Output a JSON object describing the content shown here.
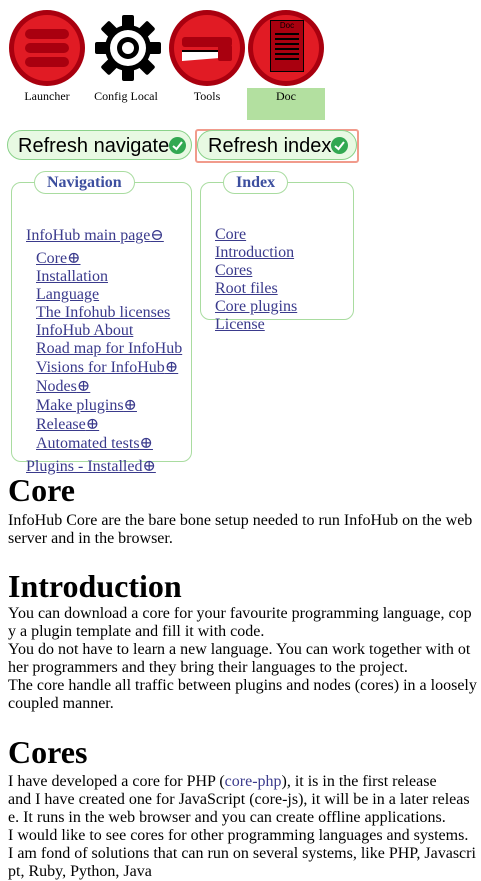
{
  "toolbar": {
    "tools": [
      {
        "label": "Launcher",
        "icon": "launcher-icon"
      },
      {
        "label": "Config Local",
        "icon": "gear-icon"
      },
      {
        "label": "Tools",
        "icon": "tools-icon"
      },
      {
        "label": "Doc",
        "icon": "doc-icon",
        "doc_badge": "Doc",
        "active": true
      }
    ]
  },
  "refresh": {
    "navigate_label": "Refresh navigate",
    "index_label": "Refresh index"
  },
  "navigation": {
    "legend": "Navigation",
    "main_page": "InfoHub main page",
    "main_page_marker": "⊖",
    "items": [
      {
        "label": "Core",
        "marker": "⊕"
      },
      {
        "label": "Installation",
        "marker": ""
      },
      {
        "label": "Language",
        "marker": ""
      },
      {
        "label": "The Infohub licenses",
        "marker": ""
      },
      {
        "label": "InfoHub About",
        "marker": ""
      },
      {
        "label": "Road map for InfoHub",
        "marker": ""
      },
      {
        "label": "Visions for InfoHub",
        "marker": "⊕"
      },
      {
        "label": "Nodes",
        "marker": "⊕"
      },
      {
        "label": "Make plugins",
        "marker": "⊕"
      },
      {
        "label": "Release",
        "marker": "⊕"
      },
      {
        "label": "Automated tests",
        "marker": "⊕"
      }
    ],
    "plugins": "Plugins - Installed",
    "plugins_marker": "⊕"
  },
  "index": {
    "legend": "Index",
    "items": [
      "Core",
      "Introduction",
      "Cores",
      "Root files",
      "Core plugins",
      "License"
    ]
  },
  "content": {
    "core_heading": "Core",
    "core_lines": [
      "InfoHub Core are the bare bone setup needed to run InfoHub on the web",
      "server and in the browser."
    ],
    "intro_heading": "Introduction",
    "intro_lines": [
      "You can download a core for your favourite programming language, cop",
      "y a plugin template and fill it with code.",
      "You do not have to learn a new language. You can work together with ot",
      "her programmers and they bring their languages to the project.",
      "The core handle all traffic between plugins and nodes (cores) in a loosely",
      "coupled manner."
    ],
    "cores_heading": "Cores",
    "cores_line1_before": "I have developed a core for PHP (",
    "cores_line1_link": "core-php",
    "cores_line1_after": "), it is in the first release",
    "cores_lines": [
      "and I have created one for JavaScript (core-js), it will be in a later releas",
      "e. It runs in the web browser and you can create offline applications.",
      "I would like to see cores for other programming languages and systems.",
      "I am fond of solutions that can run on several systems, like PHP, Javascri",
      "pt, Ruby, Python, Java"
    ]
  }
}
